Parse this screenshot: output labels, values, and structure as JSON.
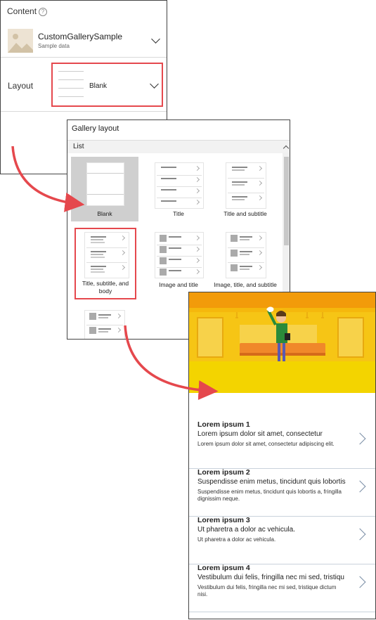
{
  "content_panel": {
    "title": "Content",
    "help_icon": "?",
    "data_source": {
      "name": "CustomGallerySample",
      "subtitle": "Sample data"
    },
    "layout": {
      "label": "Layout",
      "value": "Blank"
    }
  },
  "gallery_layout": {
    "title": "Gallery layout",
    "section": "List",
    "options": [
      {
        "label": "Blank"
      },
      {
        "label": "Title"
      },
      {
        "label": "Title and subtitle"
      },
      {
        "label": "Title, subtitle, and body"
      },
      {
        "label": "Image and title"
      },
      {
        "label": "Image, title, and subtitle"
      }
    ],
    "selected_option": "Blank",
    "highlighted_option": "Title, subtitle, and body"
  },
  "preview": {
    "items": [
      {
        "title": "Lorem ipsum 1",
        "subtitle": "Lorem ipsum dolor sit amet, consectetur",
        "body": "Lorem ipsum dolor sit amet, consectetur adipiscing elit."
      },
      {
        "title": "Lorem ipsum 2",
        "subtitle": "Suspendisse enim metus, tincidunt quis lobortis",
        "body": "Suspendisse enim metus, tincidunt quis lobortis a, fringilla dignissim neque."
      },
      {
        "title": "Lorem ipsum 3",
        "subtitle": "Ut pharetra a dolor ac vehicula.",
        "body": "Ut pharetra a dolor ac vehicula."
      },
      {
        "title": "Lorem ipsum 4",
        "subtitle": "Vestibulum dui felis, fringilla nec mi sed, tristiqu",
        "body": "Vestibulum dui felis, fringilla nec mi sed, tristique dictum nisi."
      }
    ]
  },
  "colors": {
    "highlight": "#e5484d",
    "arrow": "#e5484d",
    "hero_yellow": "#f2c40f",
    "chevron": "#7b8ea6"
  }
}
